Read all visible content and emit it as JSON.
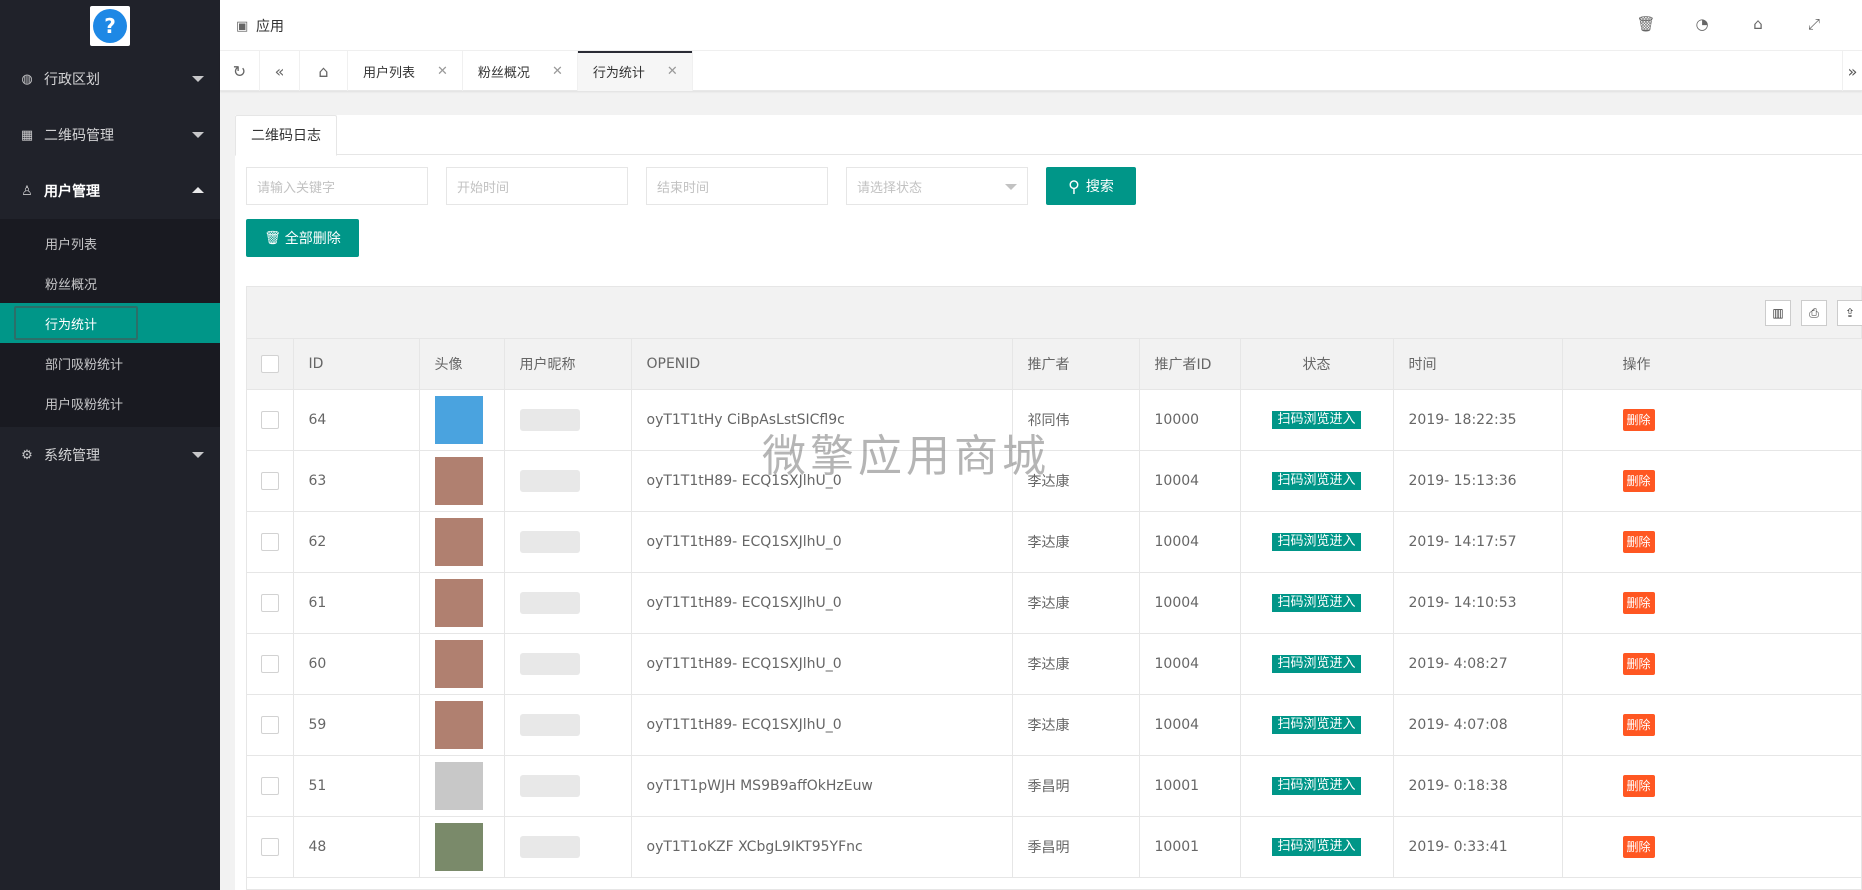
{
  "sidebar": {
    "menus": [
      {
        "label": "行政区划",
        "icon": "globe-icon"
      },
      {
        "label": "二维码管理",
        "icon": "qrcode-icon"
      },
      {
        "label": "用户管理",
        "icon": "user-icon"
      }
    ],
    "submenu": [
      "用户列表",
      "粉丝概况",
      "行为统计",
      "部门吸粉统计",
      "用户吸粉统计"
    ],
    "system": {
      "label": "系统管理",
      "icon": "gear-icon"
    }
  },
  "header": {
    "app_label": "应用"
  },
  "tabs": {
    "items": [
      "用户列表",
      "粉丝概况",
      "行为统计"
    ]
  },
  "card": {
    "tab": "二维码日志",
    "keyword_placeholder": "请输入关键字",
    "start_placeholder": "开始时间",
    "end_placeholder": "结束时间",
    "status_placeholder": "请选择状态",
    "search_label": "搜索",
    "delete_all_label": "全部删除"
  },
  "table": {
    "headers": [
      "ID",
      "头像",
      "用户昵称",
      "OPENID",
      "推广者",
      "推广者ID",
      "状态",
      "时间",
      "操作"
    ],
    "rows": [
      {
        "id": "64",
        "openid": "oyT1T1tHy CiBpAsLstSICfl9c",
        "promoter": "祁同伟",
        "promoter_id": "10000",
        "status": "扫码浏览进入",
        "time": "2019- 18:22:35",
        "action": "删除"
      },
      {
        "id": "63",
        "openid": "oyT1T1tH89- ECQ1SXJlhU_0",
        "promoter": "李达康",
        "promoter_id": "10004",
        "status": "扫码浏览进入",
        "time": "2019- 15:13:36",
        "action": "删除"
      },
      {
        "id": "62",
        "openid": "oyT1T1tH89- ECQ1SXJlhU_0",
        "promoter": "李达康",
        "promoter_id": "10004",
        "status": "扫码浏览进入",
        "time": "2019- 14:17:57",
        "action": "删除"
      },
      {
        "id": "61",
        "openid": "oyT1T1tH89- ECQ1SXJlhU_0",
        "promoter": "李达康",
        "promoter_id": "10004",
        "status": "扫码浏览进入",
        "time": "2019- 14:10:53",
        "action": "删除"
      },
      {
        "id": "60",
        "openid": "oyT1T1tH89- ECQ1SXJlhU_0",
        "promoter": "李达康",
        "promoter_id": "10004",
        "status": "扫码浏览进入",
        "time": "2019- 4:08:27",
        "action": "删除"
      },
      {
        "id": "59",
        "openid": "oyT1T1tH89- ECQ1SXJlhU_0",
        "promoter": "李达康",
        "promoter_id": "10004",
        "status": "扫码浏览进入",
        "time": "2019- 4:07:08",
        "action": "删除"
      },
      {
        "id": "51",
        "openid": "oyT1T1pWJH MS9B9affOkHzEuw",
        "promoter": "季昌明",
        "promoter_id": "10001",
        "status": "扫码浏览进入",
        "time": "2019- 0:18:38",
        "action": "删除"
      },
      {
        "id": "48",
        "openid": "oyT1T1oKZF XCbgL9IKT95YFnc",
        "promoter": "季昌明",
        "promoter_id": "10001",
        "status": "扫码浏览进入",
        "time": "2019- 0:33:41",
        "action": "删除"
      }
    ]
  },
  "watermark": "微擎应用商城",
  "colors": {
    "primary": "#009688",
    "danger": "#ff5722",
    "sidebar": "#20222a"
  }
}
